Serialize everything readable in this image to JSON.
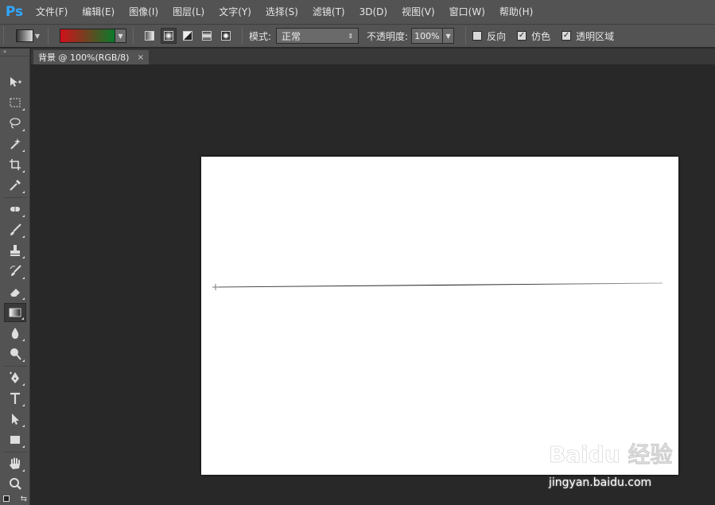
{
  "app": {
    "logo": "Ps"
  },
  "menu": [
    "文件(F)",
    "编辑(E)",
    "图像(I)",
    "图层(L)",
    "文字(Y)",
    "选择(S)",
    "滤镜(T)",
    "3D(D)",
    "视图(V)",
    "窗口(W)",
    "帮助(H)"
  ],
  "options": {
    "gradient_colors": [
      "#d0101a",
      "#0a7a2a"
    ],
    "gradient_types": [
      "linear",
      "radial",
      "angle",
      "reflected",
      "diamond"
    ],
    "active_gradient_type": "radial",
    "mode_label": "模式:",
    "mode_value": "正常",
    "opacity_label": "不透明度:",
    "opacity_value": "100%",
    "reverse_label": "反向",
    "reverse_checked": false,
    "dither_label": "仿色",
    "dither_checked": true,
    "transparency_label": "透明区域",
    "transparency_checked": true
  },
  "document": {
    "tab_title": "背景 @ 100%(RGB/8)",
    "close_symbol": "×"
  },
  "tools": [
    "move-tool",
    "marquee-tool",
    "lasso-tool",
    "magic-wand-tool",
    "crop-tool",
    "eyedropper-tool",
    "healing-brush-tool",
    "brush-tool",
    "clone-stamp-tool",
    "history-brush-tool",
    "eraser-tool",
    "gradient-tool",
    "blur-tool",
    "dodge-tool",
    "pen-tool",
    "type-tool",
    "path-selection-tool",
    "rectangle-tool",
    "hand-tool",
    "zoom-tool"
  ],
  "active_tool": "gradient-tool",
  "watermark": {
    "text": "jingyan.baidu.com",
    "logo_text": "Baidu 经验"
  }
}
